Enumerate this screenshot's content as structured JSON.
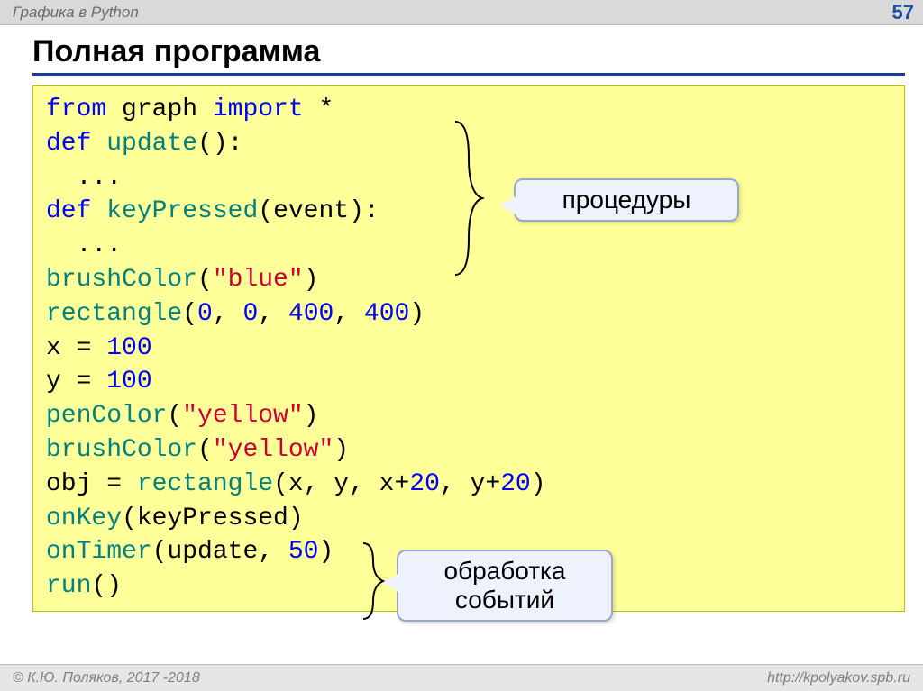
{
  "header": {
    "title": "Графика в Python",
    "page": "57"
  },
  "slide_title": "Полная программа",
  "code": {
    "l1_from": "from",
    "l1_graph": "graph",
    "l1_import": "import",
    "l1_star": "*",
    "l2_def": "def",
    "l2_name": "update",
    "l2_paren": "():",
    "l3": "  ...",
    "l4_def": "def",
    "l4_name": "keyPressed",
    "l4_paren": "(event):",
    "l5": "  ...",
    "l6_fn": "brushColor",
    "l6_open": "(",
    "l6_str": "\"blue\"",
    "l6_close": ")",
    "l7_fn": "rectangle",
    "l7_open": "(",
    "l7_a": "0",
    "l7_c1": ", ",
    "l7_b": "0",
    "l7_c2": ", ",
    "l7_c": "400",
    "l7_c3": ", ",
    "l7_d": "400",
    "l7_close": ")",
    "l8_x": "x = ",
    "l8_v": "100",
    "l9_y": "y = ",
    "l9_v": "100",
    "l10_fn": "penColor",
    "l10_open": "(",
    "l10_str": "\"yellow\"",
    "l10_close": ")",
    "l11_fn": "brushColor",
    "l11_open": "(",
    "l11_str": "\"yellow\"",
    "l11_close": ")",
    "l12_lhs": "obj = ",
    "l12_fn": "rectangle",
    "l12_args_a": "(x, y, x+",
    "l12_n1": "20",
    "l12_args_b": ", y+",
    "l12_n2": "20",
    "l12_close": ")",
    "l13_fn": "onKey",
    "l13_args": "(keyPressed)",
    "l14_fn": "onTimer",
    "l14_open": "(update, ",
    "l14_n": "50",
    "l14_close": ")",
    "l15_fn": "run",
    "l15_paren": "()"
  },
  "callouts": {
    "procedures": "процедуры",
    "events_l1": "обработка",
    "events_l2": "событий"
  },
  "footer": {
    "left": "© К.Ю. Поляков, 2017 -2018",
    "right": "http://kpolyakov.spb.ru"
  }
}
